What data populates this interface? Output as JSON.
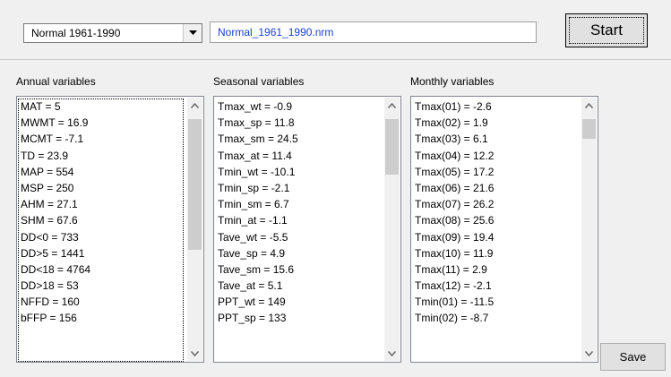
{
  "period_select": {
    "value": "Normal 1961-1990",
    "icon": "chevron-down-icon"
  },
  "normal_file": {
    "value": "Normal_1961_1990.nrm"
  },
  "start_button": {
    "label": "Start"
  },
  "save_button": {
    "label": "Save"
  },
  "annual": {
    "label": "Annual variables",
    "items": [
      "MAT = 5",
      "MWMT = 16.9",
      "MCMT = -7.1",
      "TD = 23.9",
      "MAP = 554",
      "MSP = 250",
      "AHM = 27.1",
      "SHM = 67.6",
      "DD<0 = 733",
      "DD>5 = 1441",
      "DD<18 = 4764",
      "DD>18 = 53",
      "NFFD = 160",
      "bFFP = 156"
    ]
  },
  "seasonal": {
    "label": "Seasonal variables",
    "items": [
      "Tmax_wt = -0.9",
      "Tmax_sp = 11.8",
      "Tmax_sm = 24.5",
      "Tmax_at = 11.4",
      "Tmin_wt = -10.1",
      "Tmin_sp = -2.1",
      "Tmin_sm = 6.7",
      "Tmin_at = -1.1",
      "Tave_wt = -5.5",
      "Tave_sp = 4.9",
      "Tave_sm = 15.6",
      "Tave_at = 5.1",
      "PPT_wt = 149",
      "PPT_sp = 133"
    ]
  },
  "monthly": {
    "label": "Monthly variables",
    "items": [
      "Tmax(01) = -2.6",
      "Tmax(02) = 1.9",
      "Tmax(03) = 6.1",
      "Tmax(04) = 12.2",
      "Tmax(05) = 17.2",
      "Tmax(06) = 21.6",
      "Tmax(07) = 26.2",
      "Tmax(08) = 25.6",
      "Tmax(09) = 19.4",
      "Tmax(10) = 11.9",
      "Tmax(11) = 2.9",
      "Tmax(12) = -2.1",
      "Tmin(01) = -11.5",
      "Tmin(02) = -8.7"
    ]
  }
}
